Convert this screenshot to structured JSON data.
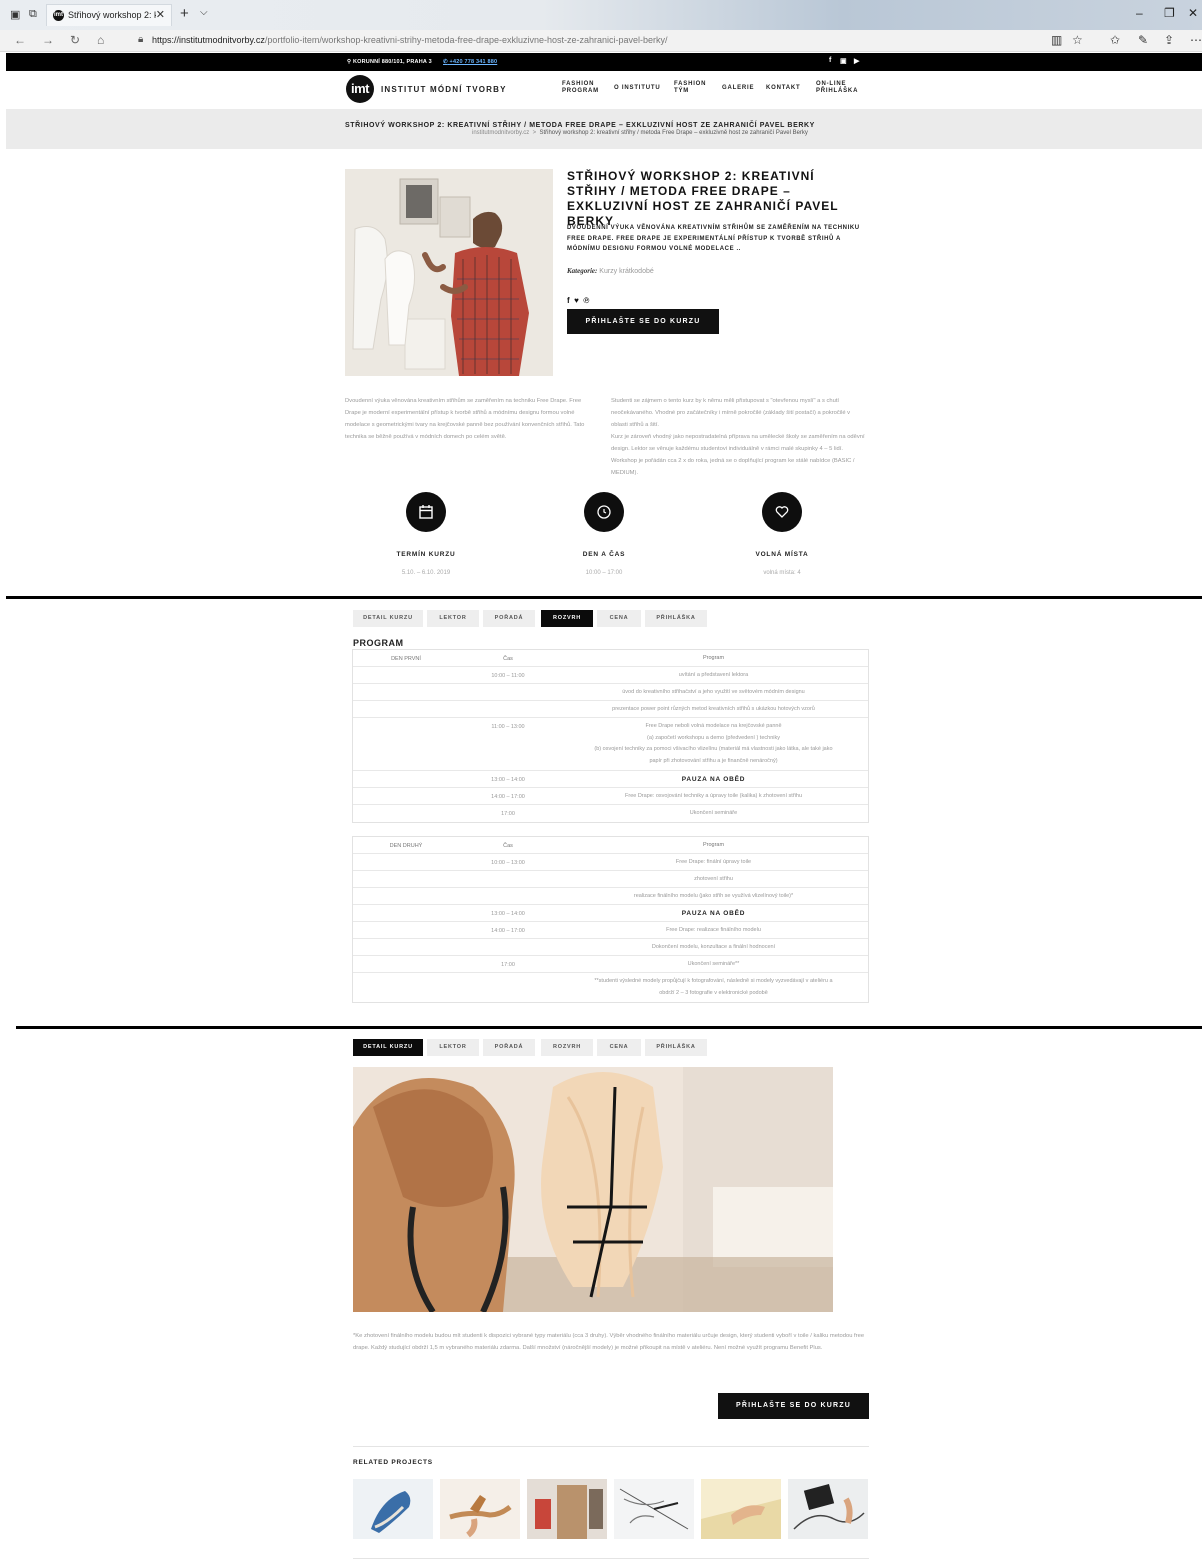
{
  "browser": {
    "tab_title": "Střihový workshop 2: kr",
    "tab_favicon": "imt",
    "url_host": "https://institutmodnitvorby.cz",
    "url_path": "/portfolio-item/workshop-kreativni-strihy-metoda-free-drape-exkluzivne-host-ze-zahranici-pavel-berky/"
  },
  "topbar": {
    "address": "⚲ KORUNNÍ 880/101, PRAHA 3",
    "phone": "+420 778 341 880",
    "phone_prefix": "✆"
  },
  "header": {
    "logo_mark": "imt",
    "logo_text": "INSTITUT MÓDNÍ TVORBY",
    "menu": [
      {
        "line1": "FASHION",
        "line2": "PROGRAM"
      },
      {
        "line1": "O INSTITUTU",
        "line2": ""
      },
      {
        "line1": "FASHION",
        "line2": "TÝM"
      },
      {
        "line1": "GALERIE",
        "line2": ""
      },
      {
        "line1": "KONTAKT",
        "line2": ""
      },
      {
        "line1": "ON-LINE",
        "line2": "PŘIHLÁŠKA"
      }
    ]
  },
  "breadcrumb": {
    "title": "STŘIHOVÝ WORKSHOP 2: KREATIVNÍ STŘIHY / METODA FREE DRAPE – EXKLUZIVNÍ HOST ZE ZAHRANIČÍ PAVEL BERKY",
    "home": "institutmodnitvorby.cz",
    "separator": ">",
    "current": "Střihový workshop 2: kreativní střihy / metoda Free Drape – exkluzivně host ze zahraničí Pavel Berky"
  },
  "article": {
    "title": "STŘIHOVÝ WORKSHOP 2: KREATIVNÍ STŘIHY / METODA FREE DRAPE – EXKLUZIVNÍ HOST ZE ZAHRANIČÍ PAVEL BERKY",
    "lead": "DVOUDENNÍ VÝUKA VĚNOVÁNA KREATIVNÍM STŘIHŮM SE ZAMĚŘENÍM NA TECHNIKU FREE DRAPE. FREE DRAPE JE EXPERIMENTÁLNÍ PŘÍSTUP K TVORBĚ STŘIHŮ A MÓDNÍMU DESIGNU FORMOU VOLNÉ MODELACE ..",
    "category_label": "Kategorie:",
    "category_value": "Kurzy krátkodobé",
    "cta": "PŘIHLAŠTE SE DO KURZU",
    "col1": "Dvoudenní výuka věnována kreativním střihům se zaměřením na techniku Free Drape. Free Drape je moderní experimentální přístup k tvorbě střihů a módnímu designu formou volné modelace s geometrickými tvary na krejčovské panně bez používání konvenčních střihů. Tato technika se běžně používá v módních domech po celém světě.",
    "col2a": "Studenti se zájmem o tento kurz by k němu měli přistupovat s \"otevřenou myslí\" a s chutí neočekávaného. Vhodné pro začátečníky i mírně pokročilé (základy šití postačí) a pokročilé v oblasti střihů a šití.",
    "col2b": "Kurz je zároveň vhodný jako nepostradatelná příprava na umělecké školy se zaměřením na oděvní design. Lektor se věnuje každému studentovi individuálně v rámci malé skupinky 4 – 5 lidí. Workshop je pořádán cca 2 x do roka, jedná se o doplňující program ke stálé nabídce (BASIC / MEDIUM)."
  },
  "stats": [
    {
      "icon": "calendar-icon",
      "label": "TERMÍN KURZU",
      "value": "5.10. – 6.10. 2019"
    },
    {
      "icon": "clock-icon",
      "label": "DEN A ČAS",
      "value": "10:00 – 17:00"
    },
    {
      "icon": "heart-icon",
      "label": "VOLNÁ MÍSTA",
      "value": "volná místa: 4"
    }
  ],
  "tabs": [
    "DETAIL KURZU",
    "LEKTOR",
    "POŘADÁ",
    "ROZVRH",
    "CENA",
    "PŘIHLÁŠKA"
  ],
  "program": {
    "title": "PROGRAM",
    "days": [
      {
        "day": "DEN PRVNÍ",
        "time_header": "Čas",
        "program_header": "Program",
        "rows": [
          {
            "time": "10:00 – 11:00",
            "text": [
              "uvítání a představení lektora"
            ],
            "bold": false
          },
          {
            "time": "",
            "text": [
              "úvod do kreativního střihačství a jeho využití ve světovém módním designu"
            ],
            "bold": false
          },
          {
            "time": "",
            "text": [
              "prezentace power point různých metod kreativních střihů s ukázkou hotových vzorů"
            ],
            "bold": false
          },
          {
            "time": "11:00 – 13:00",
            "text": [
              "Free Drape neboli volná modelace na krejčovské panně",
              "(a) započetí workshopu a demo (předvedení ) techniky",
              "(b) osvojení techniky za pomoci všivacího vlizelínu (materiál má vlastnosti jako látka, ale také jako",
              "papír při zhotovování střihu a je finančně nenáročný)"
            ],
            "bold": false
          },
          {
            "time": "13:00 – 14:00",
            "text": [
              "PAUZA NA OBĚD"
            ],
            "bold": true
          },
          {
            "time": "14:00 – 17:00",
            "text": [
              "Free Drape: osvojování techniky a úpravy toile (kalika) k zhotovení střihu"
            ],
            "bold": false
          },
          {
            "time": "17:00",
            "text": [
              "Ukončení semináře"
            ],
            "bold": false
          }
        ]
      },
      {
        "day": "DEN DRUHÝ",
        "time_header": "Čas",
        "program_header": "Program",
        "rows": [
          {
            "time": "10:00 – 13:00",
            "text": [
              "Free Drape: finální úpravy toile"
            ],
            "bold": false
          },
          {
            "time": "",
            "text": [
              "zhotovení střihu"
            ],
            "bold": false
          },
          {
            "time": "",
            "text": [
              "realizace finálního modelu (jako střih se využívá vlizelínový toile)*"
            ],
            "bold": false
          },
          {
            "time": "13:00 – 14:00",
            "text": [
              "PAUZA NA OBĚD"
            ],
            "bold": true
          },
          {
            "time": "14:00 – 17:00",
            "text": [
              "Free Drape: realizace finálního modelu"
            ],
            "bold": false
          },
          {
            "time": "",
            "text": [
              "Dokončení modelu, konzultace a finální hodnocení"
            ],
            "bold": false
          },
          {
            "time": "17:00",
            "text": [
              "Ukončení semináře**"
            ],
            "bold": false
          },
          {
            "time": "",
            "text": [
              "**studenti výsledné modely propůjčují k fotografování, následně si modely vyzvedávají v ateliéru a",
              "obdrží 2 – 3 fotografie v elektronické podobě"
            ],
            "bold": false
          }
        ]
      }
    ]
  },
  "detail": {
    "note": "*Ke zhotovení finálního modelu budou mít studenti k dispozici vybrané typy materiálu (cca 3 druhy). Výběr vhodného finálního materiálu určuje design, který studenti vyboří v toile / kaliku metodou free drape. Každý studující obdrží 1,5 m vybraného materiálu zdarma. Další množství (náročnější modely) je možné přikoupit na místě v ateliéru. Není možné využít programu Benefit Plus.",
    "cta": "PŘIHLAŠTE SE DO KURZU",
    "related_title": "RELATED PROJECTS"
  }
}
